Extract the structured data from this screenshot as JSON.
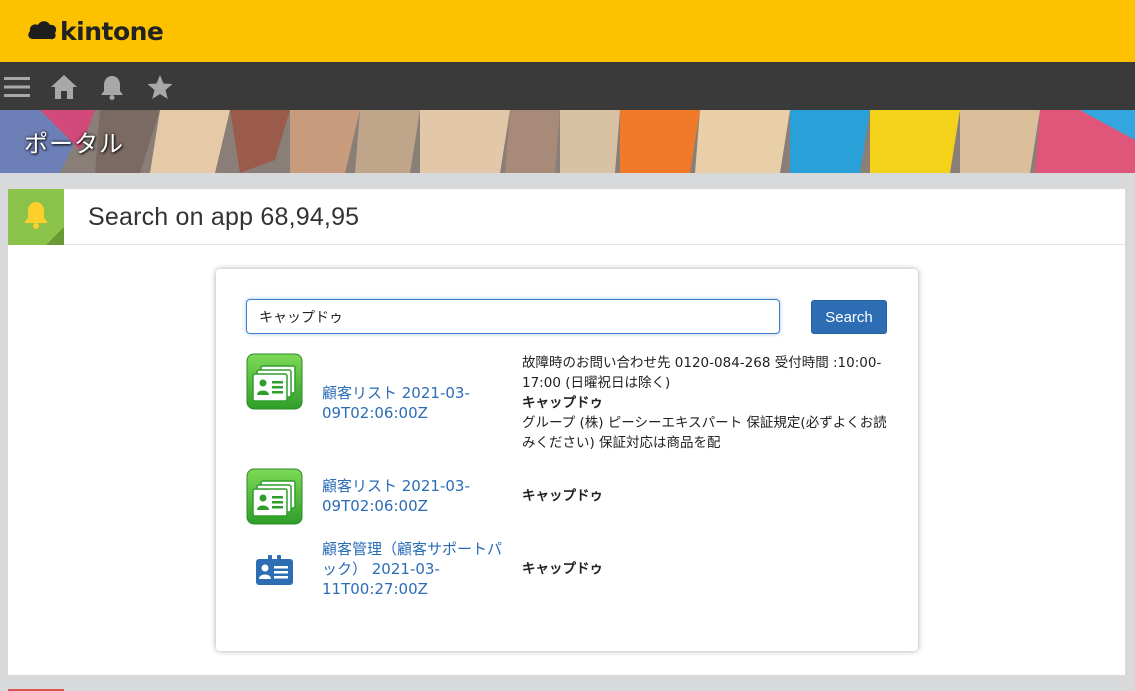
{
  "brand": {
    "name": "kintone"
  },
  "nav": {
    "icons": [
      "menu-icon",
      "home-icon",
      "bell-icon",
      "star-icon"
    ]
  },
  "banner": {
    "title": "ポータル"
  },
  "section": {
    "title": "Search on app 68,94,95",
    "icon": "bell-icon",
    "accent_color": "#8bc34a"
  },
  "search": {
    "value": "キャップドゥ",
    "button_label": "Search"
  },
  "results": [
    {
      "icon": "customer-list-icon",
      "link": "顧客リスト 2021-03-09T02:06:00Z",
      "snippet_pre": "故障時のお問い合わせ先 0120-084-268 受付時間 :10:00-17:00 (日曜祝日は除く)",
      "highlight": "キャップドゥ",
      "snippet_post": "グループ (株) ピーシーエキスパート 保証規定(必ずよくお読みください) 保証対応は商品を配"
    },
    {
      "icon": "customer-list-icon",
      "link": "顧客リスト 2021-03-09T02:06:00Z",
      "snippet_pre": "",
      "highlight": "キャップドゥ",
      "snippet_post": ""
    },
    {
      "icon": "customer-card-icon",
      "link": "顧客管理（顧客サポートパック） 2021-03-11T00:27:00Z",
      "snippet_pre": "",
      "highlight": "キャップドゥ",
      "snippet_post": ""
    }
  ],
  "colors": {
    "brand_yellow": "#fcc200",
    "nav_dark": "#3a3a3a",
    "link_blue": "#2a6cb6",
    "button_blue": "#2c6db4"
  }
}
